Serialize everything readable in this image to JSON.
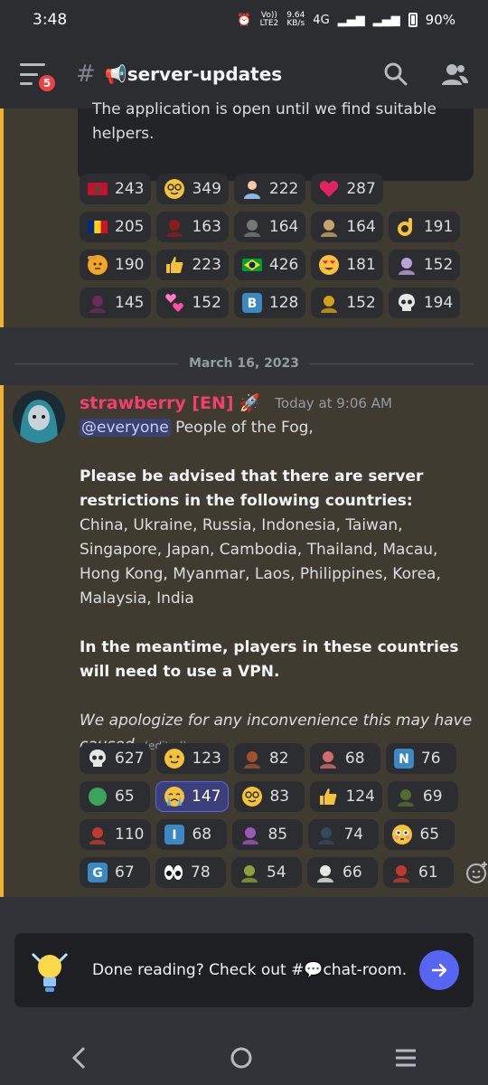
{
  "status": {
    "time": "3:48",
    "volte": "Vo))",
    "lte": "LTE2",
    "speed": "9.64",
    "speed_unit": "KB/s",
    "net": "4G",
    "battery": "90%"
  },
  "header": {
    "badge": "5",
    "channel": "📢server-updates"
  },
  "prev_message": {
    "lines": [
      "The application is open until we find suitable",
      "helpers."
    ],
    "reactions": [
      [
        {
          "emoji": "flag-icon",
          "color": "#c8102e",
          "count": "243"
        },
        {
          "emoji": "nerd-icon",
          "color": "#f5c33b",
          "count": "349"
        },
        {
          "emoji": "person-icon",
          "color": "#8fb8de",
          "count": "222"
        },
        {
          "emoji": "heart-icon",
          "color": "#e0245e",
          "count": "287"
        }
      ],
      [
        {
          "emoji": "flag-ro-icon",
          "color": "#fcd116",
          "count": "205"
        },
        {
          "emoji": "avatar-icon",
          "color": "#8a1c1c",
          "count": "163"
        },
        {
          "emoji": "avatar-icon",
          "color": "#777777",
          "count": "164"
        },
        {
          "emoji": "avatar-icon",
          "color": "#c9a36b",
          "count": "164"
        },
        {
          "emoji": "ok-hand-icon",
          "color": "#f5c33b",
          "count": "191"
        }
      ],
      [
        {
          "emoji": "salute-icon",
          "color": "#f5a623",
          "count": "190"
        },
        {
          "emoji": "thumbs-up-icon",
          "color": "#f5c33b",
          "count": "223"
        },
        {
          "emoji": "flag-br-icon",
          "color": "#009c3b",
          "count": "426"
        },
        {
          "emoji": "heart-eyes-icon",
          "color": "#f5c33b",
          "count": "181"
        },
        {
          "emoji": "avatar-icon",
          "color": "#b9a3d6",
          "count": "152"
        }
      ],
      [
        {
          "emoji": "avatar-icon",
          "color": "#6b2a5a",
          "count": "145"
        },
        {
          "emoji": "hearts-icon",
          "color": "#ff7ac6",
          "count": "152"
        },
        {
          "emoji": "letter-b-icon",
          "color": "#3b88c3",
          "letter": "B",
          "count": "128"
        },
        {
          "emoji": "avatar-icon",
          "color": "#d4a017",
          "count": "152"
        },
        {
          "emoji": "skull-icon",
          "color": "#dddddd",
          "count": "194"
        }
      ]
    ]
  },
  "divider": "March 16, 2023",
  "message": {
    "username": "strawberry [EN]",
    "timestamp": "Today at 9:06 AM",
    "mention": "@everyone",
    "greeting": " People of the Fog,",
    "bold1": "Please be advised that there are server restrictions in the following countries:",
    "countries": "China, Ukraine, Russia, Indonesia, Taiwan, Singapore, Japan, Cambodia, Thailand, Macau, Hong  Kong, Myanmar, Laos, Philippines, Korea, Malaysia, India",
    "bold2": "In the meantime, players in these countries will need to use a VPN.",
    "italic": "We apologize for any inconvenience this may have caused.",
    "edited": "(edited)",
    "reactions": [
      [
        {
          "emoji": "skull-icon",
          "color": "#dddddd",
          "count": "627"
        },
        {
          "emoji": "slight-smile-icon",
          "color": "#f5c33b",
          "count": "123"
        },
        {
          "emoji": "avatar-icon",
          "color": "#a0522d",
          "count": "82"
        },
        {
          "emoji": "avatar-icon",
          "color": "#d46b6b",
          "count": "68"
        },
        {
          "emoji": "letter-n-icon",
          "color": "#3b88c3",
          "letter": "N",
          "count": "76"
        }
      ],
      [
        {
          "emoji": "green-circle-icon",
          "color": "#3ba55c",
          "count": "65"
        },
        {
          "emoji": "crying-icon",
          "color": "#f5c33b",
          "count": "147",
          "active": true
        },
        {
          "emoji": "nerd-icon",
          "color": "#f5c33b",
          "count": "83"
        },
        {
          "emoji": "thumbs-up-icon",
          "color": "#f5c33b",
          "count": "124"
        },
        {
          "emoji": "avatar-icon",
          "color": "#556b2f",
          "count": "69"
        }
      ],
      [
        {
          "emoji": "avatar-icon",
          "color": "#c0392b",
          "count": "110"
        },
        {
          "emoji": "letter-i-icon",
          "color": "#3b88c3",
          "letter": "I",
          "count": "68"
        },
        {
          "emoji": "avatar-icon",
          "color": "#9b59b6",
          "count": "85"
        },
        {
          "emoji": "avatar-icon",
          "color": "#34495e",
          "count": "74"
        },
        {
          "emoji": "flushed-icon",
          "color": "#f5c33b",
          "count": "65"
        }
      ],
      [
        {
          "emoji": "letter-g-icon",
          "color": "#3b88c3",
          "letter": "G",
          "count": "67"
        },
        {
          "emoji": "eyes-icon",
          "color": "#ffffff",
          "count": "78"
        },
        {
          "emoji": "avatar-icon",
          "color": "#8e9f3b",
          "count": "54"
        },
        {
          "emoji": "avatar-icon",
          "color": "#e8e8e8",
          "count": "66"
        },
        {
          "emoji": "avatar-icon",
          "color": "#c0392b",
          "count": "61"
        }
      ]
    ]
  },
  "bottom": {
    "text": "Done reading? Check out #💬chat-room."
  },
  "colors": {
    "accent": "#5865f2",
    "username": "#f23f6b",
    "highlight_bar": "#f0b232",
    "badge": "#f23f43"
  }
}
